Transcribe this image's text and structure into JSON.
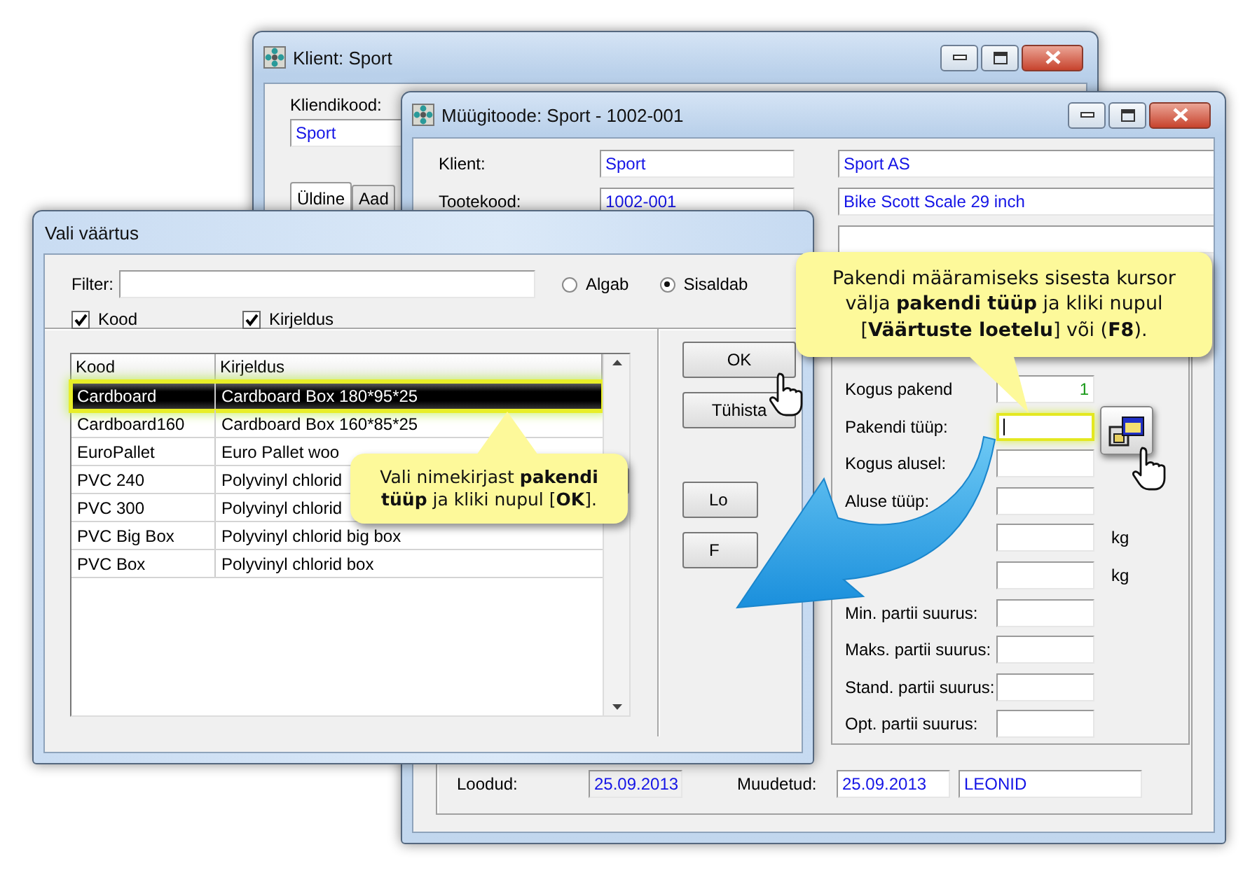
{
  "client_window": {
    "title": "Klient: Sport",
    "code_label": "Kliendikood:",
    "code": "Sport",
    "tabs": [
      {
        "label": "Üldine",
        "selected": true
      },
      {
        "label": "Aad",
        "selected": false
      }
    ]
  },
  "product_window": {
    "title": "Müügitoode: Sport - 1002-001",
    "header_rows": [
      {
        "label": "Klient:",
        "code": "Sport",
        "name": "Sport AS"
      },
      {
        "label": "Tootekood:",
        "code": "1002-001",
        "name": "Bike Scott Scale 29 inch"
      }
    ],
    "packaging_fields": [
      {
        "label": "Kogus pakend",
        "value": "1",
        "highlighted": false
      },
      {
        "label": "Pakendi tüüp:",
        "highlighted": true
      },
      {
        "label": "Kogus alusel:",
        "highlighted": false
      },
      {
        "label": "Aluse tüüp:",
        "highlighted": false
      },
      {
        "unit": "kg",
        "highlighted": false
      },
      {
        "unit": "kg",
        "highlighted": false
      },
      {
        "label": "Min. partii suurus:",
        "highlighted": false
      },
      {
        "label": "Maks. partii suurus:",
        "highlighted": false
      },
      {
        "label": "Stand. partii suurus:",
        "highlighted": false
      },
      {
        "label": "Opt. partii suurus:",
        "highlighted": false
      }
    ],
    "footer": {
      "created_label": "Loodud:",
      "created": "25.09.2013",
      "modified_label": "Muudetud:",
      "modified": "25.09.2013",
      "user": "LEONID"
    }
  },
  "dialog": {
    "title": "Vali väärtus",
    "filter_label": "Filter:",
    "match_options": [
      {
        "label": "Algab",
        "selected": false
      },
      {
        "label": "Sisaldab",
        "selected": true
      }
    ],
    "search_in": [
      {
        "label": "Kood",
        "checked": true
      },
      {
        "label": "Kirjeldus",
        "checked": true
      }
    ],
    "columns": [
      "Kood",
      "Kirjeldus"
    ],
    "rows": [
      {
        "code": "Cardboard",
        "description": "Cardboard Box 180*95*25",
        "selected": true
      },
      {
        "code": "Cardboard160",
        "description": "Cardboard Box 160*85*25",
        "selected": false
      },
      {
        "code": "EuroPallet",
        "description": "Euro Pallet woo",
        "selected": false
      },
      {
        "code": "PVC 240",
        "description": "Polyvinyl chlorid",
        "selected": false
      },
      {
        "code": "PVC 300",
        "description": "Polyvinyl chlorid",
        "selected": false
      },
      {
        "code": "PVC Big Box",
        "description": "Polyvinyl chlorid big box",
        "selected": false
      },
      {
        "code": "PVC Box",
        "description": "Polyvinyl chlorid box",
        "selected": false
      }
    ],
    "buttons": [
      {
        "label": "OK"
      },
      {
        "label": "Tühista"
      },
      {
        "label": "Lo"
      },
      {
        "label": "F"
      }
    ]
  },
  "callouts": [
    {
      "kind": "pointer-down",
      "text": "Pakendi määramiseks sisesta kursor välja **pakendi tüüp** ja kliki nupul [**Väärtuste loetelu**] või (**F8**)."
    },
    {
      "kind": "pointer-up",
      "text": "Vali nimekirjast **pakendi tüüp** ja kliki nupul [**OK**]."
    }
  ]
}
